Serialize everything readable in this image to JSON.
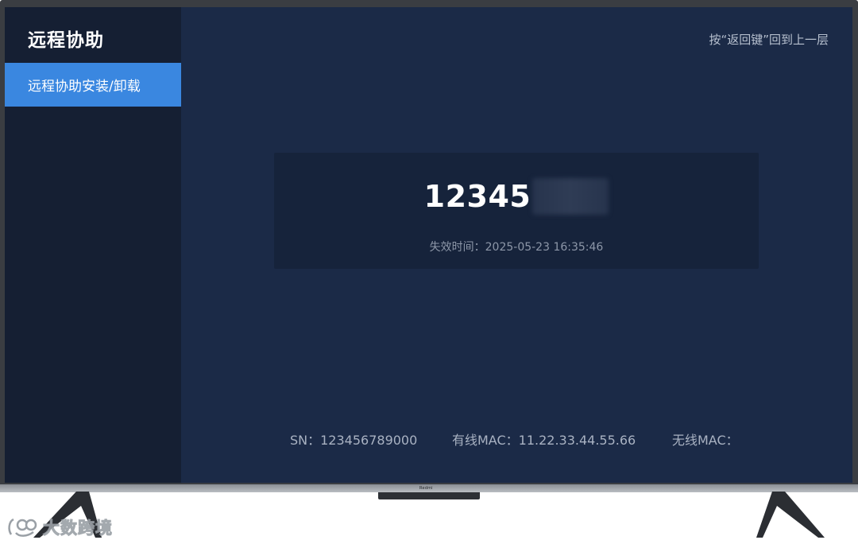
{
  "sidebar": {
    "title": "远程协助",
    "items": [
      {
        "label": "远程协助安装/卸载",
        "selected": true
      }
    ]
  },
  "header": {
    "back_hint": "按“返回键”回到上一层"
  },
  "assist": {
    "code_visible": "12345",
    "code_blurred": true,
    "expire_text": "失效时间：2025-05-23 16:35:46"
  },
  "device": {
    "sn": "SN：123456789000",
    "wired_mac": "有线MAC：11.22.33.44.55.66",
    "wireless_mac": "无线MAC："
  },
  "tv": {
    "brand": "Redmi"
  },
  "watermark": {
    "text": "大数跨境"
  },
  "colors": {
    "screen_bg": "#1b2a47",
    "sidebar_bg": "#151f33",
    "accent": "#3a87e0",
    "card_bg": "#16233b"
  }
}
